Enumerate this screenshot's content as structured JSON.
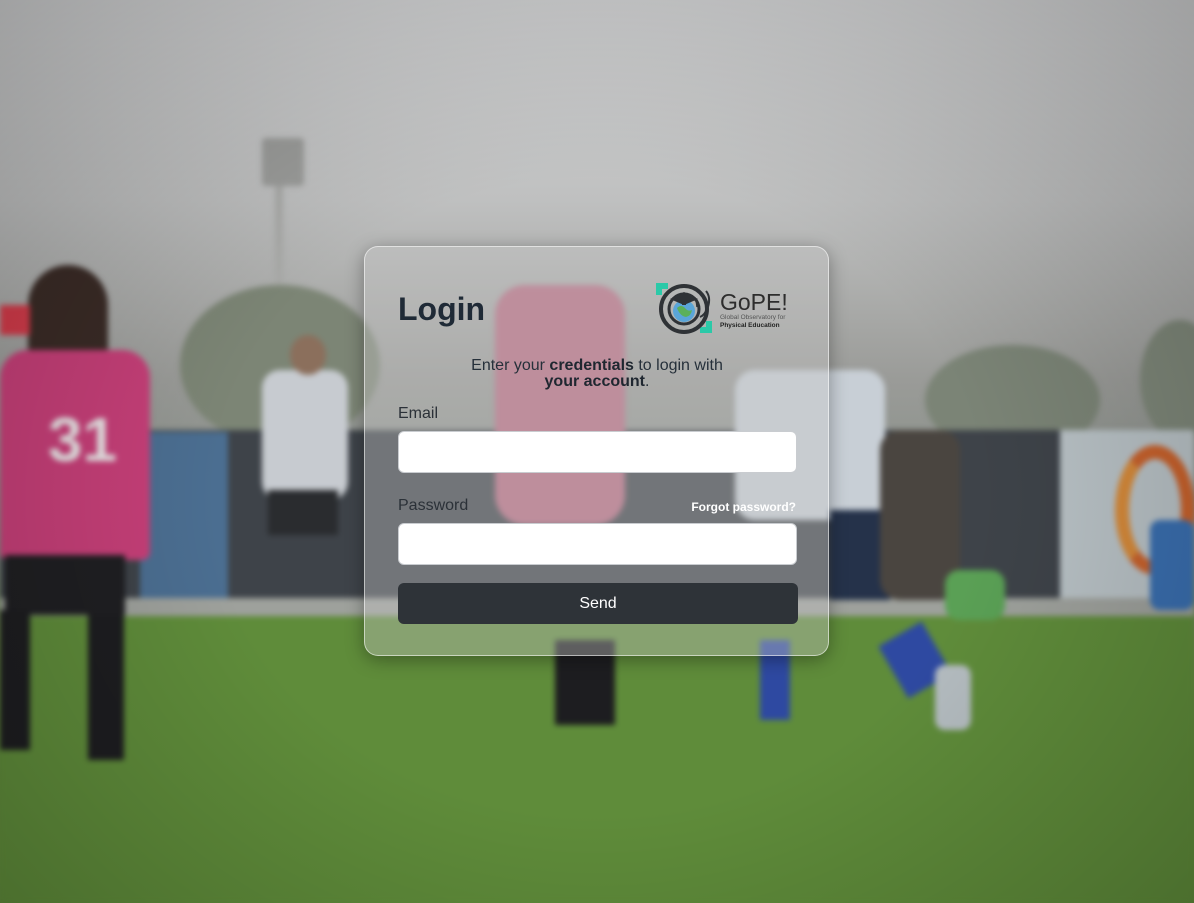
{
  "login": {
    "title": "Login",
    "logo": {
      "name": "GoPE!",
      "subtitle_line1": "Global Observatory for",
      "subtitle_line2": "Physical Education"
    },
    "intro": {
      "part1": "Enter your ",
      "bold1": "credentials",
      "part2": " to login with",
      "bold2": "your account",
      "part3": "."
    },
    "email": {
      "label": "Email",
      "value": "",
      "placeholder": ""
    },
    "password": {
      "label": "Password",
      "value": "",
      "placeholder": "",
      "forgot_label": "Forgot password?"
    },
    "send_label": "Send"
  },
  "background": {
    "jersey_number": "31"
  }
}
